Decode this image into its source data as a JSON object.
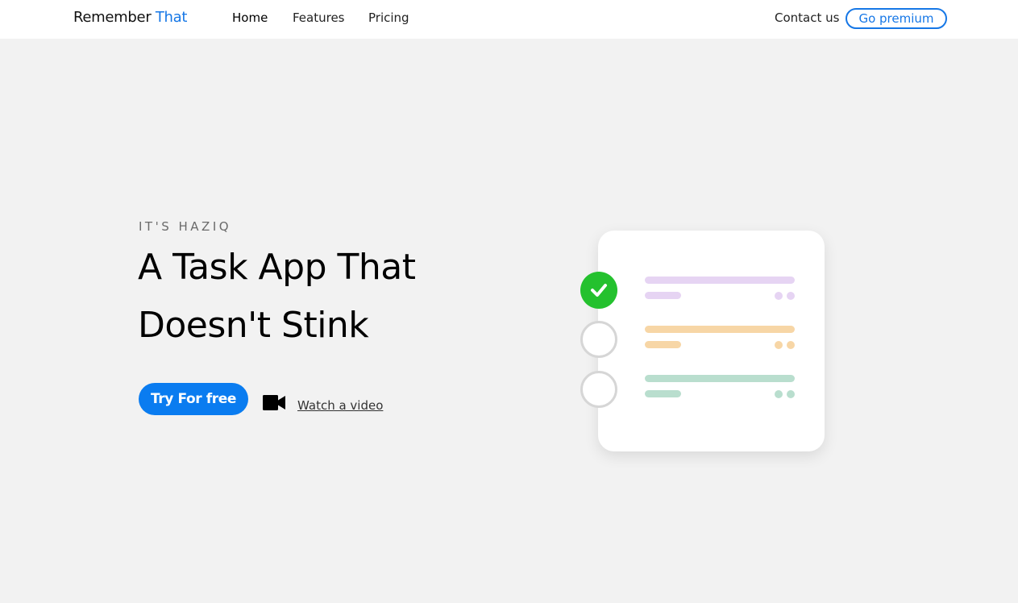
{
  "brand": {
    "name": "Remember",
    "accent": "That",
    "accent_color": "#1677e6"
  },
  "nav": {
    "home": "Home",
    "features": "Features",
    "pricing": "Pricing",
    "contact": "Contact us",
    "premium": "Go premium"
  },
  "hero": {
    "eyebrow": "IT'S HAZIQ",
    "title_line1": "A Task App That",
    "title_line2": "Doesn't Stink",
    "cta": "Try For free",
    "video_link": "Watch a video",
    "video_icon": "video-camera-icon"
  },
  "illustration": {
    "tasks": [
      {
        "done": true,
        "color": "#e6d4f3",
        "check_color": "#24c12e"
      },
      {
        "done": false,
        "color": "#f7d6a6"
      },
      {
        "done": false,
        "color": "#b9dece"
      }
    ]
  },
  "colors": {
    "primary": "#0a7cf0",
    "background": "#f2f2f2"
  }
}
